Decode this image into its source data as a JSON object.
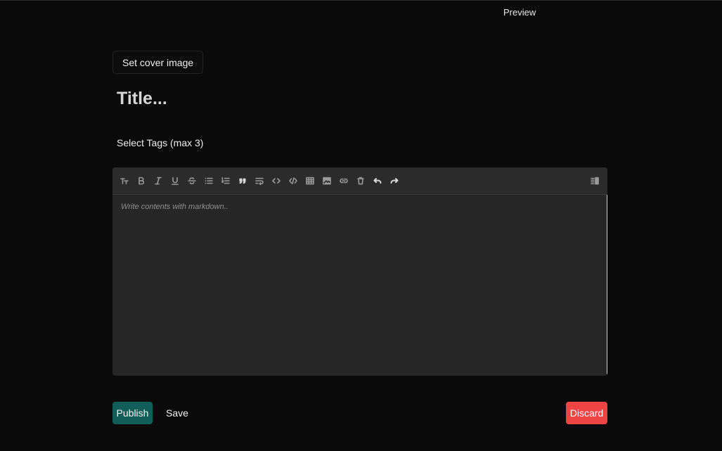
{
  "header": {
    "preview_label": "Preview"
  },
  "cover": {
    "button_label": "Set cover image"
  },
  "title": {
    "placeholder": "Title..."
  },
  "tags": {
    "label": "Select Tags (max 3)"
  },
  "editor": {
    "placeholder": "Write contents with markdown..",
    "toolbar": [
      "heading-icon",
      "bold-icon",
      "italic-icon",
      "underline-icon",
      "strikethrough-icon",
      "bullet-list-icon",
      "ordered-list-icon",
      "quote-icon",
      "wrap-icon",
      "inline-code-icon",
      "code-block-icon",
      "table-icon",
      "image-icon",
      "link-icon",
      "delete-icon",
      "undo-icon",
      "redo-icon",
      "preview-toggle-icon"
    ]
  },
  "actions": {
    "publish_label": "Publish",
    "save_label": "Save",
    "discard_label": "Discard"
  },
  "colors": {
    "background": "#0a0a0a",
    "editor_bg": "#262626",
    "publish": "#115e59",
    "discard": "#ef4444"
  }
}
